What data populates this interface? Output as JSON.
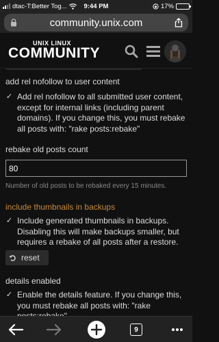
{
  "status_bar": {
    "carrier": "dtac-T:Better Tog...",
    "time": "9:44 PM",
    "battery_pct": "17%",
    "battery_level": 0.17,
    "battery_color": "#e33333"
  },
  "browser": {
    "url": "community.unix.com",
    "lock_icon": "lock-icon",
    "share_icon": "share-icon"
  },
  "site": {
    "logo_top": "UNIX LINUX",
    "logo_main": "COMMUNITY",
    "search_icon": "search-icon",
    "menu_icon": "hamburger-icon",
    "avatar": "user-avatar"
  },
  "settings": {
    "nofollow": {
      "title": "add rel nofollow to user content",
      "checked": true,
      "description": "Add rel nofollow to all submitted user content, except for internal links (including parent domains). If you change this, you must rebake all posts with: \"rake posts:rebake\""
    },
    "rebake": {
      "title": "rebake old posts count",
      "value": "80",
      "help": "Number of old posts to be rebaked every 15 minutes."
    },
    "thumbnails": {
      "title": "include thumbnails in backups",
      "title_color": "#c8893d",
      "checked": true,
      "description": "Include generated thumbnails in backups. Disabling this will make backups smaller, but requires a rebake of all posts after a restore.",
      "reset_label": "reset"
    },
    "details": {
      "title": "details enabled",
      "checked": true,
      "description": "Enable the details feature. If you change this, you must rebake all posts with: \"rake posts:rebake\"."
    }
  },
  "toolbar": {
    "back_icon": "back-arrow-icon",
    "forward_icon": "forward-arrow-icon",
    "new_tab_icon": "plus-icon",
    "tabs_count": "9",
    "more_icon": "more-icon"
  }
}
